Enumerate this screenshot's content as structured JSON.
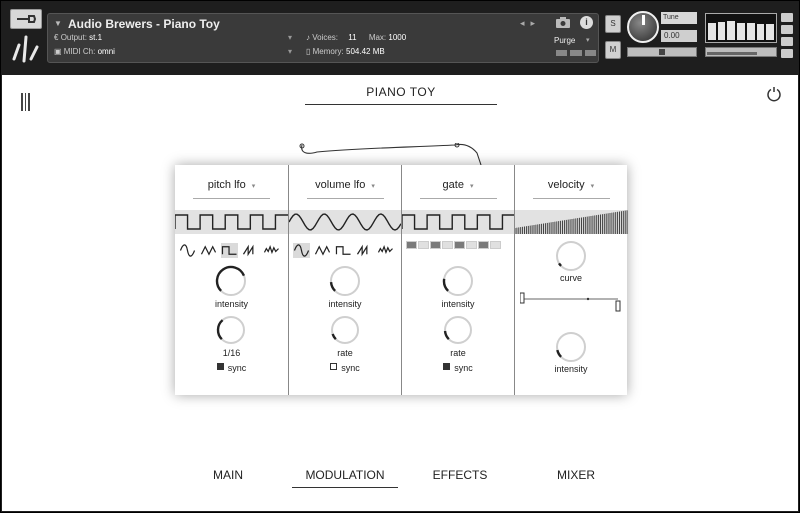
{
  "header": {
    "instrument_name": "Audio Brewers - Piano Toy",
    "output_label": "Output:",
    "output_value": "st.1",
    "midi_label": "MIDI Ch:",
    "midi_value": "omni",
    "voices_label": "Voices:",
    "voices_value": "11",
    "max_label": "Max:",
    "max_value": "1000",
    "memory_label": "Memory:",
    "memory_value": "504.42 MB",
    "purge_label": "Purge",
    "solo_label": "S",
    "mute_label": "M",
    "tune_label": "Tune",
    "tune_value": "0.00",
    "meter_levels": [
      0.7,
      0.75,
      0.8,
      0.72,
      0.7,
      0.68,
      0.66
    ]
  },
  "page": {
    "title": "PIANO TOY"
  },
  "modulators": [
    {
      "name": "pitch lfo",
      "wave": "square",
      "selected_shape": 2,
      "knob1_label": "intensity",
      "knob1_value": 0.75,
      "knob2_label": "1/16",
      "knob2_value": 0.35,
      "sync_label": "sync",
      "sync_on": true
    },
    {
      "name": "volume lfo",
      "wave": "sine",
      "selected_shape": 0,
      "knob1_label": "intensity",
      "knob1_value": 0.15,
      "knob2_label": "rate",
      "knob2_value": 0.1,
      "sync_label": "sync",
      "sync_on": false
    },
    {
      "name": "gate",
      "wave": "square",
      "knob1_label": "intensity",
      "knob1_value": 0.2,
      "knob2_label": "rate",
      "knob2_value": 0.15,
      "sync_label": "sync",
      "sync_on": true
    },
    {
      "name": "velocity",
      "wave": "ramp",
      "knob1_label": "curve",
      "knob1_value": 0.05,
      "knob2_label": "intensity",
      "knob2_value": 0.12
    }
  ],
  "tabs": [
    {
      "label": "MAIN",
      "active": false
    },
    {
      "label": "MODULATION",
      "active": true
    },
    {
      "label": "EFFECTS",
      "active": false
    },
    {
      "label": "MIXER",
      "active": false
    }
  ]
}
